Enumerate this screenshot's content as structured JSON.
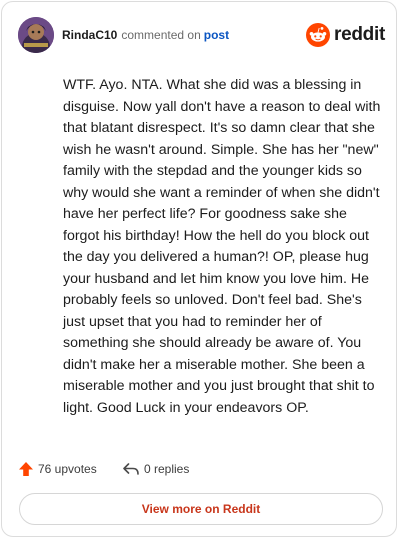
{
  "header": {
    "username": "RindaC10",
    "action": "commented on",
    "post_link": "post",
    "brand": "reddit",
    "avatar_icon": "avatar-image",
    "brand_icon": "reddit-logo-icon"
  },
  "comment": {
    "text": "WTF. Ayo. NTA. What she did was a blessing in disguise. Now yall don't have a reason to deal with that blatant disrespect. It's so damn clear that she wish he wasn't around. Simple. She has her \"new\" family with the stepdad and the younger kids so why would she want a reminder of when she didn't have her perfect life? For goodness sake she forgot his birthday! How the hell do you block out the day you delivered a human?! OP, please hug your husband and let him know you love him. He probably feels so unloved. Don't feel bad. She's just upset that you had to reminder her of something she should already be aware of. You didn't make her a miserable mother. She been a miserable mother and you just brought that shit to light. Good Luck in your endeavors OP."
  },
  "footer": {
    "upvotes": "76 upvotes",
    "replies": "0 replies",
    "upvote_icon": "upvote-arrow-icon",
    "reply_icon": "reply-arrow-icon"
  },
  "view_more": "View more on Reddit",
  "colors": {
    "accent": "#ff4500",
    "link": "#0a55c2",
    "view_more": "#c8361b"
  }
}
